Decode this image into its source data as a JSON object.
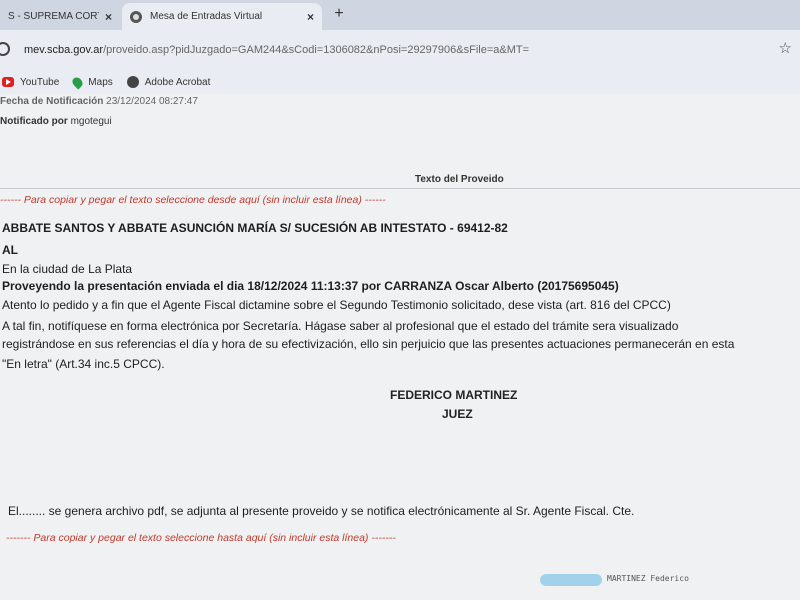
{
  "tabs": [
    {
      "title": "S - SUPREMA CORTE",
      "active": false
    },
    {
      "title": "Mesa de Entradas Virtual",
      "active": true
    }
  ],
  "new_tab_label": "+",
  "close_label": "×",
  "address": {
    "host": "mev.scba.gov.ar",
    "path": "/proveido.asp?pidJuzgado=GAM244&sCodi=1306082&nPosi=29297906&sFile=a&MT="
  },
  "star_glyph": "☆",
  "bookmarks": [
    {
      "label": "YouTube",
      "icon": "youtube-icon"
    },
    {
      "label": "Maps",
      "icon": "maps-icon"
    },
    {
      "label": "Adobe Acrobat",
      "icon": "acrobat-icon"
    }
  ],
  "meta": {
    "fecha_label": "Fecha de Notificación",
    "fecha_value": "23/12/2024 08:27:47",
    "notificado_label": "Notificado por",
    "notificado_value": "mgotegui"
  },
  "section_title": "Texto del Proveido",
  "copy_start": "------ Para copiar y pegar el texto seleccione desde aquí (sin incluir esta línea) ------",
  "copy_end": "------- Para copiar y pegar el texto seleccione hasta aquí (sin incluir esta línea) -------",
  "document": {
    "caratula": "ABBATE SANTOS Y ABBATE ASUNCIÓN MARÍA S/ SUCESIÓN AB INTESTATO - 69412-82",
    "al": "AL",
    "ciudad": "En la ciudad de La Plata",
    "proveyendo": "Proveyendo la presentación enviada el dia 18/12/2024 11:13:37 por CARRANZA Oscar Alberto (20175695045)",
    "body1": "Atento lo pedido y a fin que el Agente Fiscal dictamine sobre el Segundo Testimonio solicitado, dese vista (art. 816 del CPCC)",
    "body2": "A tal fin, notifíquese en forma electrónica por Secretaría. Hágase saber al profesional que el estado del trámite sera visualizado",
    "body3": "registrándose en sus referencias el día y hora de su efectivización, ello sin perjuicio que las presentes actuaciones permanecerán en esta",
    "body4": "\"En letra\" (Art.34 inc.5 CPCC).",
    "signer": "FEDERICO MARTINEZ",
    "signer_title": "JUEZ",
    "el_line": "El........ se genera archivo pdf, se adjunta al presente proveido y se notifica electrónicamente al Sr. Agente Fiscal. Cte."
  },
  "footer_stamp": "MARTINEZ Federico"
}
